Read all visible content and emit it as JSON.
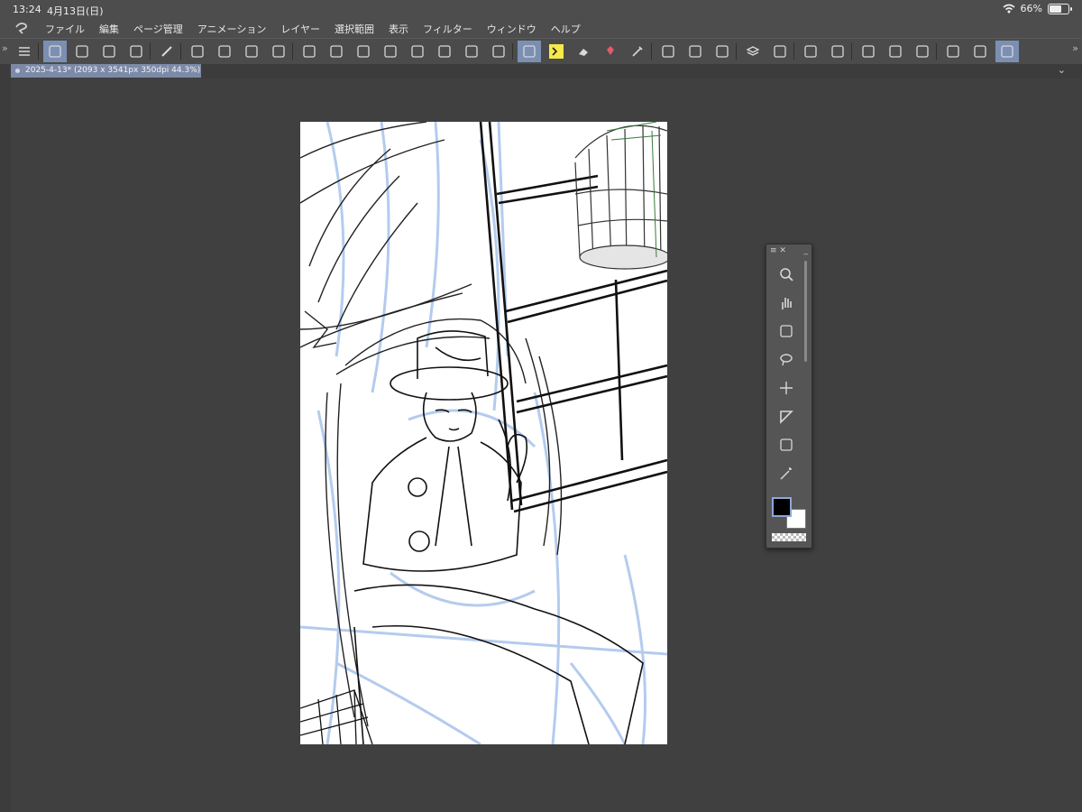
{
  "status_bar": {
    "time": "13:24",
    "date": "4月13日(日)",
    "battery_percent": "66%",
    "battery_level": 0.66
  },
  "menu": {
    "items": [
      "ファイル",
      "編集",
      "ページ管理",
      "アニメーション",
      "レイヤー",
      "選択範囲",
      "表示",
      "フィルター",
      "ウィンドウ",
      "ヘルプ"
    ]
  },
  "toolbar": {
    "tools": [
      "menu-icon",
      "pen-settings-icon",
      "undo-redo-icon",
      "pressure-icon",
      "ruler-icon",
      "brush-icon",
      "layer-move-icon",
      "perspective-icon",
      "flip-updown-icon",
      "shape-icon",
      "crop-icon",
      "transform-updown-icon",
      "flip-icon",
      "lasso-icon",
      "rotate-icon",
      "sparkle-icon",
      "blend-icon",
      "blend2-icon",
      "pen-active-icon",
      "pen-yellow-icon",
      "eraser-icon",
      "fill-bucket-icon",
      "eyedropper-icon",
      "check-icon",
      "draw-icon",
      "adjust-icon",
      "layers-icon",
      "record-icon",
      "grid-icon",
      "edit-icon",
      "stroke-icon",
      "tone-icon",
      "text-icon",
      "filmstrip-icon",
      "image-icon",
      "page-icon"
    ],
    "active_color": "#7b8fb3",
    "highlight_color": "#f4ea4a"
  },
  "document": {
    "tab_title": "2025-4-13* (2093 x 3541px 350dpi 44.3%)"
  },
  "palette": {
    "tools": [
      "zoom-icon",
      "hand-icon",
      "object-select-icon",
      "lasso-select-icon",
      "move-icon",
      "ruler-tool-icon",
      "operation-icon",
      "magic-wand-icon"
    ],
    "main_color": "#000000",
    "sub_color": "#ffffff"
  }
}
